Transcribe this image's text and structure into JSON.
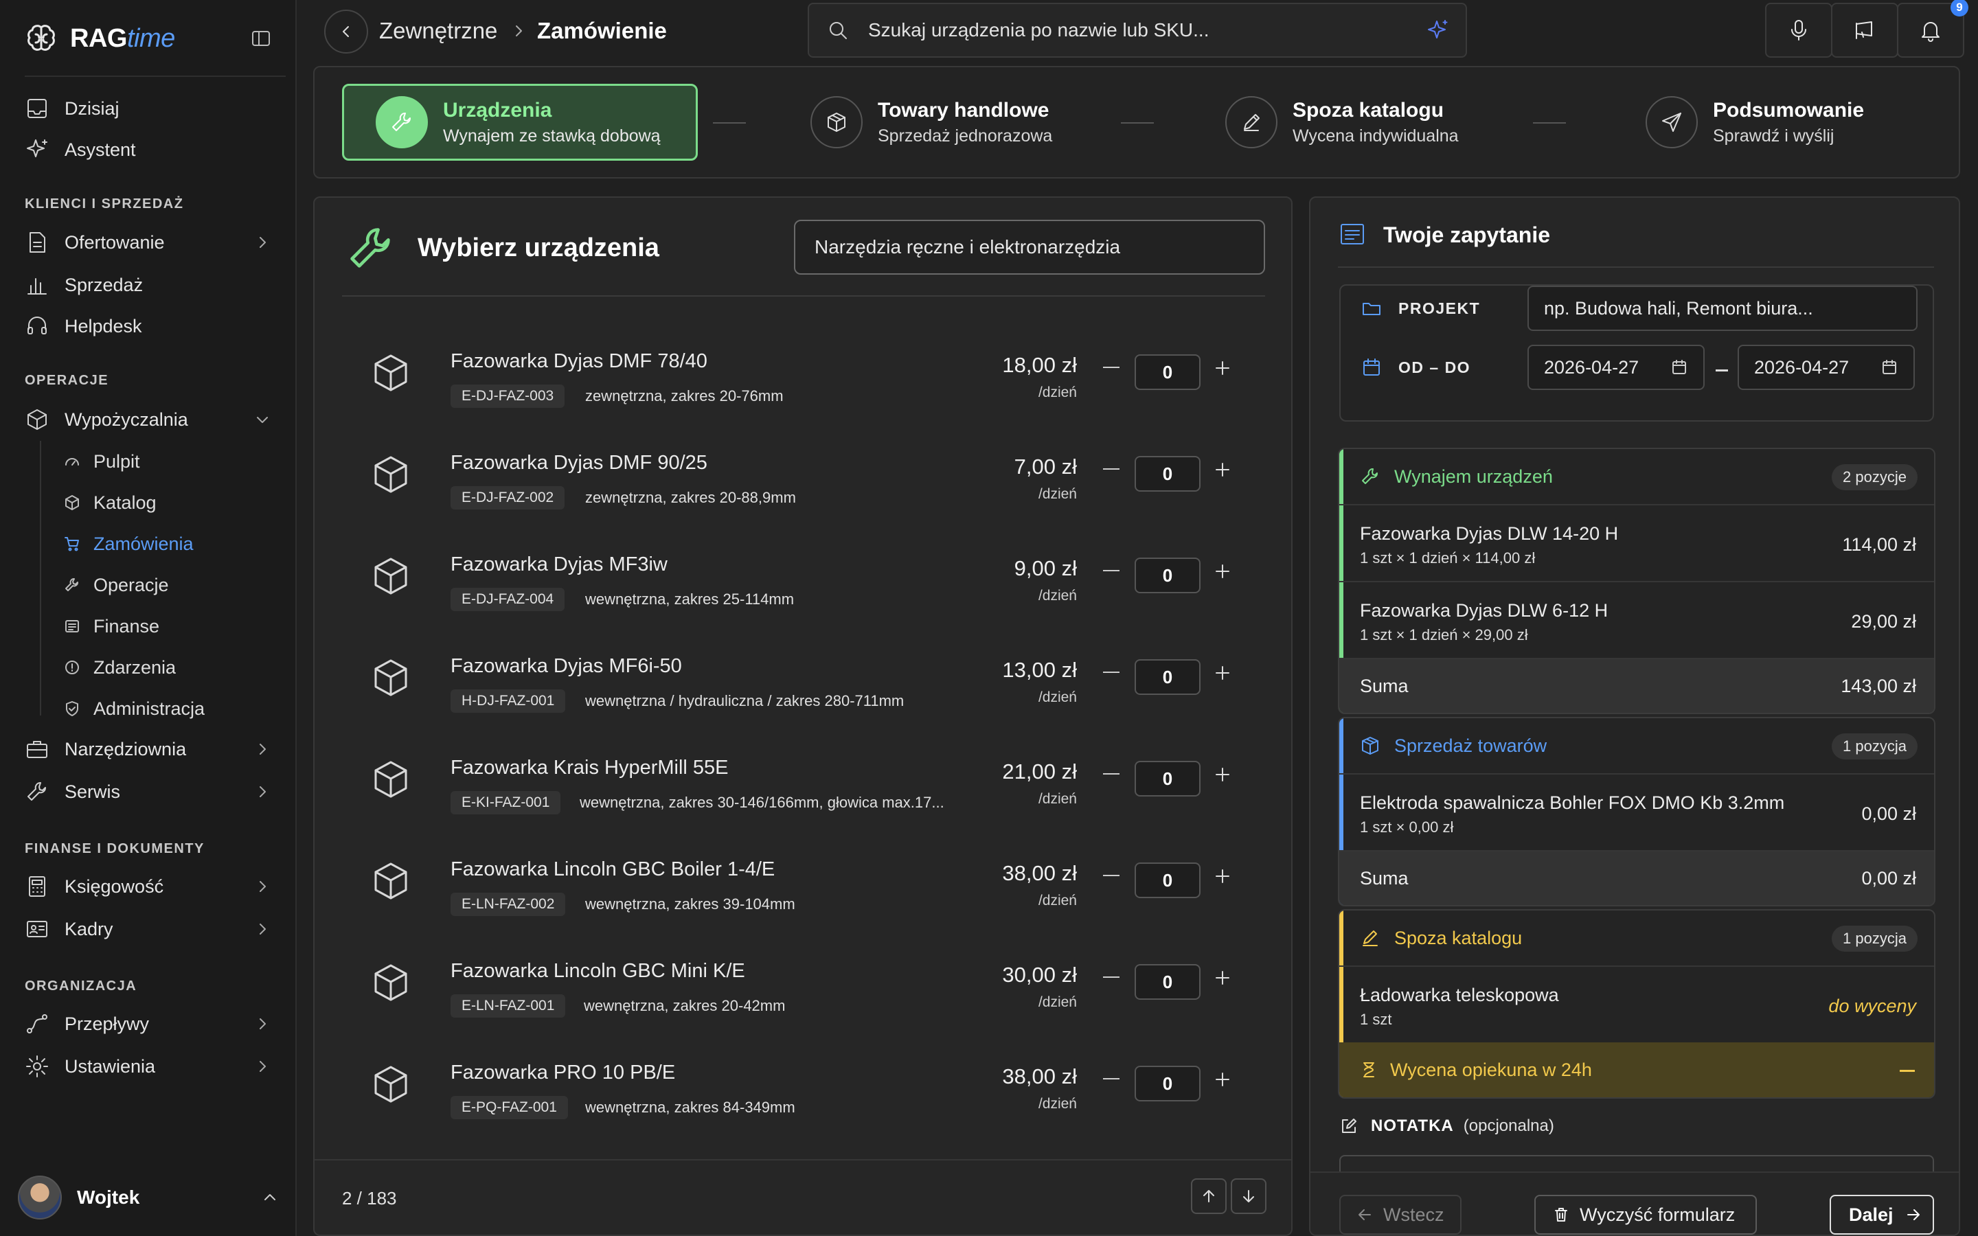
{
  "app": {
    "logo_main": "RAG",
    "logo_accent": "time"
  },
  "sidebar": {
    "top_items": [
      {
        "label": "Dzisiaj",
        "icon": "inbox-icon"
      },
      {
        "label": "Asystent",
        "icon": "sparkles-icon"
      }
    ],
    "sections": {
      "clients": "KLIENCI I SPRZEDAŻ",
      "operations": "OPERACJE",
      "finance": "FINANSE I DOKUMENTY",
      "organization": "ORGANIZACJA"
    },
    "clients_items": [
      {
        "label": "Ofertowanie",
        "icon": "document-icon"
      },
      {
        "label": "Sprzedaż",
        "icon": "bar-chart-icon"
      },
      {
        "label": "Helpdesk",
        "icon": "headset-icon"
      }
    ],
    "rental": {
      "label": "Wypożyczalnia",
      "icon": "cube-icon"
    },
    "rental_sub": [
      {
        "label": "Pulpit",
        "icon": "dashboard-icon"
      },
      {
        "label": "Katalog",
        "icon": "cube-icon"
      },
      {
        "label": "Zamówienia",
        "icon": "cart-icon"
      },
      {
        "label": "Operacje",
        "icon": "wrench-icon"
      },
      {
        "label": "Finanse",
        "icon": "list-icon"
      },
      {
        "label": "Zdarzenia",
        "icon": "alert-icon"
      },
      {
        "label": "Administracja",
        "icon": "shield-icon"
      }
    ],
    "operations_more": [
      {
        "label": "Narzędziownia",
        "icon": "toolbox-icon"
      },
      {
        "label": "Serwis",
        "icon": "wrench-icon"
      }
    ],
    "finance_items": [
      {
        "label": "Księgowość",
        "icon": "calculator-icon"
      },
      {
        "label": "Kadry",
        "icon": "id-card-icon"
      }
    ],
    "organization_items": [
      {
        "label": "Przepływy",
        "icon": "flow-icon"
      },
      {
        "label": "Ustawienia",
        "icon": "gear-icon"
      }
    ],
    "user": {
      "name": "Wojtek"
    }
  },
  "header": {
    "breadcrumb": [
      "Zewnętrzne",
      "Zamówienie"
    ],
    "search_placeholder": "Szukaj urządzenia po nazwie lub SKU...",
    "notification_count": "9"
  },
  "stepper": [
    {
      "title": "Urządzenia",
      "subtitle": "Wynajem ze stawką dobową",
      "icon": "wrench-icon",
      "active": true
    },
    {
      "title": "Towary handlowe",
      "subtitle": "Sprzedaż jednorazowa",
      "icon": "box-icon",
      "active": false
    },
    {
      "title": "Spoza katalogu",
      "subtitle": "Wycena indywidualna",
      "icon": "pencil-icon",
      "active": false
    },
    {
      "title": "Podsumowanie",
      "subtitle": "Sprawdź i wyślij",
      "icon": "send-icon",
      "active": false
    }
  ],
  "catalog": {
    "title": "Wybierz urządzenia",
    "filter": "Narzędzia ręczne i elektronarzędzia",
    "unit": "/dzień",
    "items": [
      {
        "name": "Fazowarka Dyjas DMF 78/40",
        "sku": "E-DJ-FAZ-003",
        "desc": "zewnętrzna, zakres 20-76mm",
        "price": "18,00 zł",
        "qty": "0"
      },
      {
        "name": "Fazowarka Dyjas DMF 90/25",
        "sku": "E-DJ-FAZ-002",
        "desc": "zewnętrzna, zakres 20-88,9mm",
        "price": "7,00 zł",
        "qty": "0"
      },
      {
        "name": "Fazowarka Dyjas MF3iw",
        "sku": "E-DJ-FAZ-004",
        "desc": "wewnętrzna, zakres 25-114mm",
        "price": "9,00 zł",
        "qty": "0"
      },
      {
        "name": "Fazowarka Dyjas MF6i-50",
        "sku": "H-DJ-FAZ-001",
        "desc": "wewnętrzna / hydrauliczna / zakres 280-711mm",
        "price": "13,00 zł",
        "qty": "0"
      },
      {
        "name": "Fazowarka Krais HyperMill 55E",
        "sku": "E-KI-FAZ-001",
        "desc": "wewnętrzna, zakres 30-146/166mm, głowica max.17...",
        "price": "21,00 zł",
        "qty": "0"
      },
      {
        "name": "Fazowarka Lincoln GBC Boiler 1-4/E",
        "sku": "E-LN-FAZ-002",
        "desc": "wewnętrzna, zakres 39-104mm",
        "price": "38,00 zł",
        "qty": "0"
      },
      {
        "name": "Fazowarka Lincoln GBC Mini K/E",
        "sku": "E-LN-FAZ-001",
        "desc": "wewnętrzna, zakres 20-42mm",
        "price": "30,00 zł",
        "qty": "0"
      },
      {
        "name": "Fazowarka PRO 10 PB/E",
        "sku": "E-PQ-FAZ-001",
        "desc": "wewnętrzna, zakres 84-349mm",
        "price": "38,00 zł",
        "qty": "0"
      }
    ],
    "pagination": "2 / 183"
  },
  "inquiry": {
    "title": "Twoje zapytanie",
    "project_label": "PROJEKT",
    "project_placeholder": "np. Budowa hali, Remont biura...",
    "dates_label": "OD – DO",
    "date_from": "2026-04-27",
    "date_to": "2026-04-27",
    "rental": {
      "title": "Wynajem urządzeń",
      "badge": "2 pozycje",
      "color": "#7bdc8a",
      "rows": [
        {
          "name": "Fazowarka Dyjas DLW 14-20 H",
          "sub": "1 szt × 1 dzień × 114,00 zł",
          "value": "114,00 zł"
        },
        {
          "name": "Fazowarka Dyjas DLW 6-12 H",
          "sub": "1 szt × 1 dzień × 29,00 zł",
          "value": "29,00 zł"
        }
      ],
      "sum_label": "Suma",
      "sum_value": "143,00 zł"
    },
    "sales": {
      "title": "Sprzedaż towarów",
      "badge": "1 pozycja",
      "color": "#5b9cf5",
      "rows": [
        {
          "name": "Elektroda spawalnicza Bohler FOX DMO Kb 3.2mm",
          "sub": "1 szt × 0,00 zł",
          "value": "0,00 zł"
        }
      ],
      "sum_label": "Suma",
      "sum_value": "0,00 zł"
    },
    "custom": {
      "title": "Spoza katalogu",
      "badge": "1 pozycja",
      "color": "#f2c94c",
      "rows": [
        {
          "name": "Ładowarka teleskopowa",
          "sub": "1 szt",
          "value": "do wyceny"
        }
      ],
      "warning": "Wycena opiekuna w 24h"
    },
    "note_label": "NOTATKA",
    "note_optional": "(opcjonalna)",
    "buttons": {
      "back": "Wstecz",
      "clear": "Wyczyść formularz",
      "next": "Dalej"
    }
  }
}
